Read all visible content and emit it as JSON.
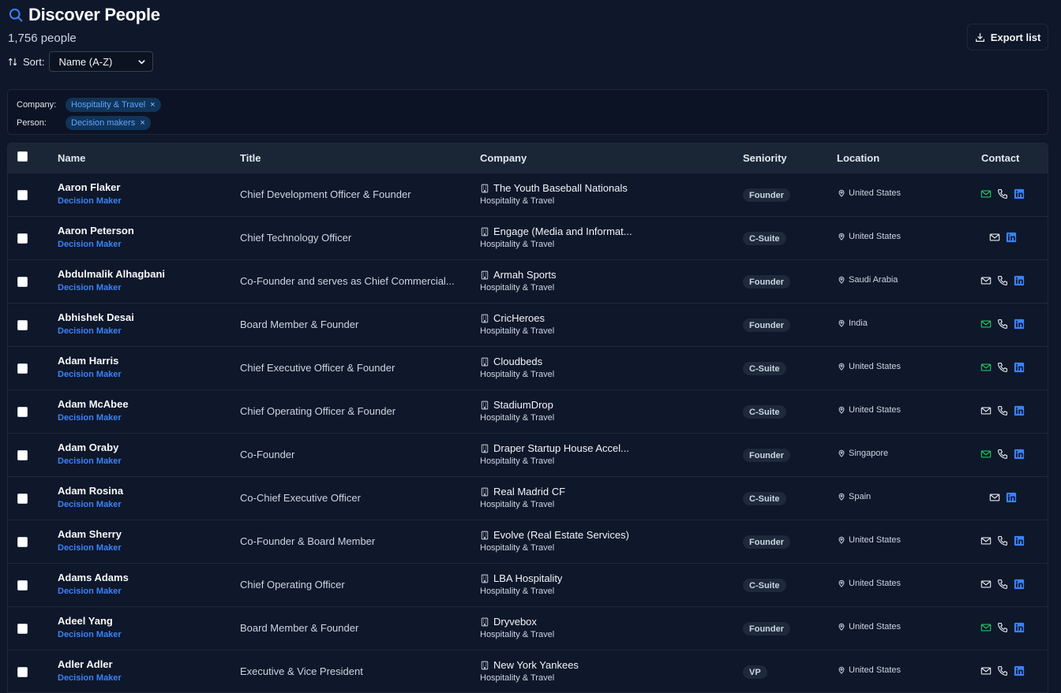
{
  "header": {
    "title": "Discover People",
    "count": "1,756 people",
    "sort_label": "Sort:",
    "sort_value": "Name (A-Z)",
    "export_label": "Export list"
  },
  "filters": {
    "company_label": "Company:",
    "company_chip": "Hospitality & Travel",
    "person_label": "Person:",
    "person_chip": "Decision makers",
    "remove_glyph": "×"
  },
  "table": {
    "headers": {
      "name": "Name",
      "title": "Title",
      "company": "Company",
      "seniority": "Seniority",
      "location": "Location",
      "contact": "Contact"
    },
    "rows": [
      {
        "name": "Aaron Flaker",
        "role": "Decision Maker",
        "title": "Chief Development Officer & Founder",
        "company": "The Youth Baseball Nationals",
        "industry": "Hospitality & Travel",
        "seniority": "Founder",
        "location": "United States",
        "email_verified": true,
        "phone": true,
        "linkedin": true
      },
      {
        "name": "Aaron Peterson",
        "role": "Decision Maker",
        "title": "Chief Technology Officer",
        "company": "Engage (Media and Informat...",
        "industry": "Hospitality & Travel",
        "seniority": "C-Suite",
        "location": "United States",
        "email_verified": false,
        "phone": false,
        "linkedin": true
      },
      {
        "name": "Abdulmalik Alhagbani",
        "role": "Decision Maker",
        "title": "Co-Founder and serves as Chief Commercial...",
        "company": "Armah Sports",
        "industry": "Hospitality & Travel",
        "seniority": "Founder",
        "location": "Saudi Arabia",
        "email_verified": false,
        "phone": true,
        "linkedin": true
      },
      {
        "name": "Abhishek Desai",
        "role": "Decision Maker",
        "title": "Board Member & Founder",
        "company": "CricHeroes",
        "industry": "Hospitality & Travel",
        "seniority": "Founder",
        "location": "India",
        "email_verified": true,
        "phone": true,
        "linkedin": true
      },
      {
        "name": "Adam Harris",
        "role": "Decision Maker",
        "title": "Chief Executive Officer & Founder",
        "company": "Cloudbeds",
        "industry": "Hospitality & Travel",
        "seniority": "C-Suite",
        "location": "United States",
        "email_verified": true,
        "phone": true,
        "linkedin": true
      },
      {
        "name": "Adam McAbee",
        "role": "Decision Maker",
        "title": "Chief Operating Officer & Founder",
        "company": "StadiumDrop",
        "industry": "Hospitality & Travel",
        "seniority": "C-Suite",
        "location": "United States",
        "email_verified": false,
        "phone": true,
        "linkedin": true
      },
      {
        "name": "Adam Oraby",
        "role": "Decision Maker",
        "title": "Co-Founder",
        "company": "Draper Startup House Accel...",
        "industry": "Hospitality & Travel",
        "seniority": "Founder",
        "location": "Singapore",
        "email_verified": true,
        "phone": true,
        "linkedin": true
      },
      {
        "name": "Adam Rosina",
        "role": "Decision Maker",
        "title": "Co-Chief Executive Officer",
        "company": "Real Madrid CF",
        "industry": "Hospitality & Travel",
        "seniority": "C-Suite",
        "location": "Spain",
        "email_verified": false,
        "phone": false,
        "linkedin": true
      },
      {
        "name": "Adam Sherry",
        "role": "Decision Maker",
        "title": "Co-Founder & Board Member",
        "company": "Evolve (Real Estate Services)",
        "industry": "Hospitality & Travel",
        "seniority": "Founder",
        "location": "United States",
        "email_verified": false,
        "phone": true,
        "linkedin": true
      },
      {
        "name": "Adams Adams",
        "role": "Decision Maker",
        "title": "Chief Operating Officer",
        "company": "LBA Hospitality",
        "industry": "Hospitality & Travel",
        "seniority": "C-Suite",
        "location": "United States",
        "email_verified": false,
        "phone": true,
        "linkedin": true
      },
      {
        "name": "Adeel Yang",
        "role": "Decision Maker",
        "title": "Board Member & Founder",
        "company": "Dryvebox",
        "industry": "Hospitality & Travel",
        "seniority": "Founder",
        "location": "United States",
        "email_verified": true,
        "phone": true,
        "linkedin": true
      },
      {
        "name": "Adler Adler",
        "role": "Decision Maker",
        "title": "Executive & Vice President",
        "company": "New York Yankees",
        "industry": "Hospitality & Travel",
        "seniority": "VP",
        "location": "United States",
        "email_verified": false,
        "phone": true,
        "linkedin": true
      }
    ]
  },
  "colors": {
    "accent": "#3b82f6",
    "email_verified": "#22c55e",
    "icon_default": "#e2e8f0",
    "linkedin": "#3b82f6"
  },
  "icons": {
    "title": "search-icon",
    "sort": "sort-arrows-icon",
    "export": "download-icon",
    "company": "building-icon",
    "location": "map-pin-icon",
    "email": "mail-icon",
    "phone": "phone-icon",
    "linkedin": "linkedin-icon"
  }
}
